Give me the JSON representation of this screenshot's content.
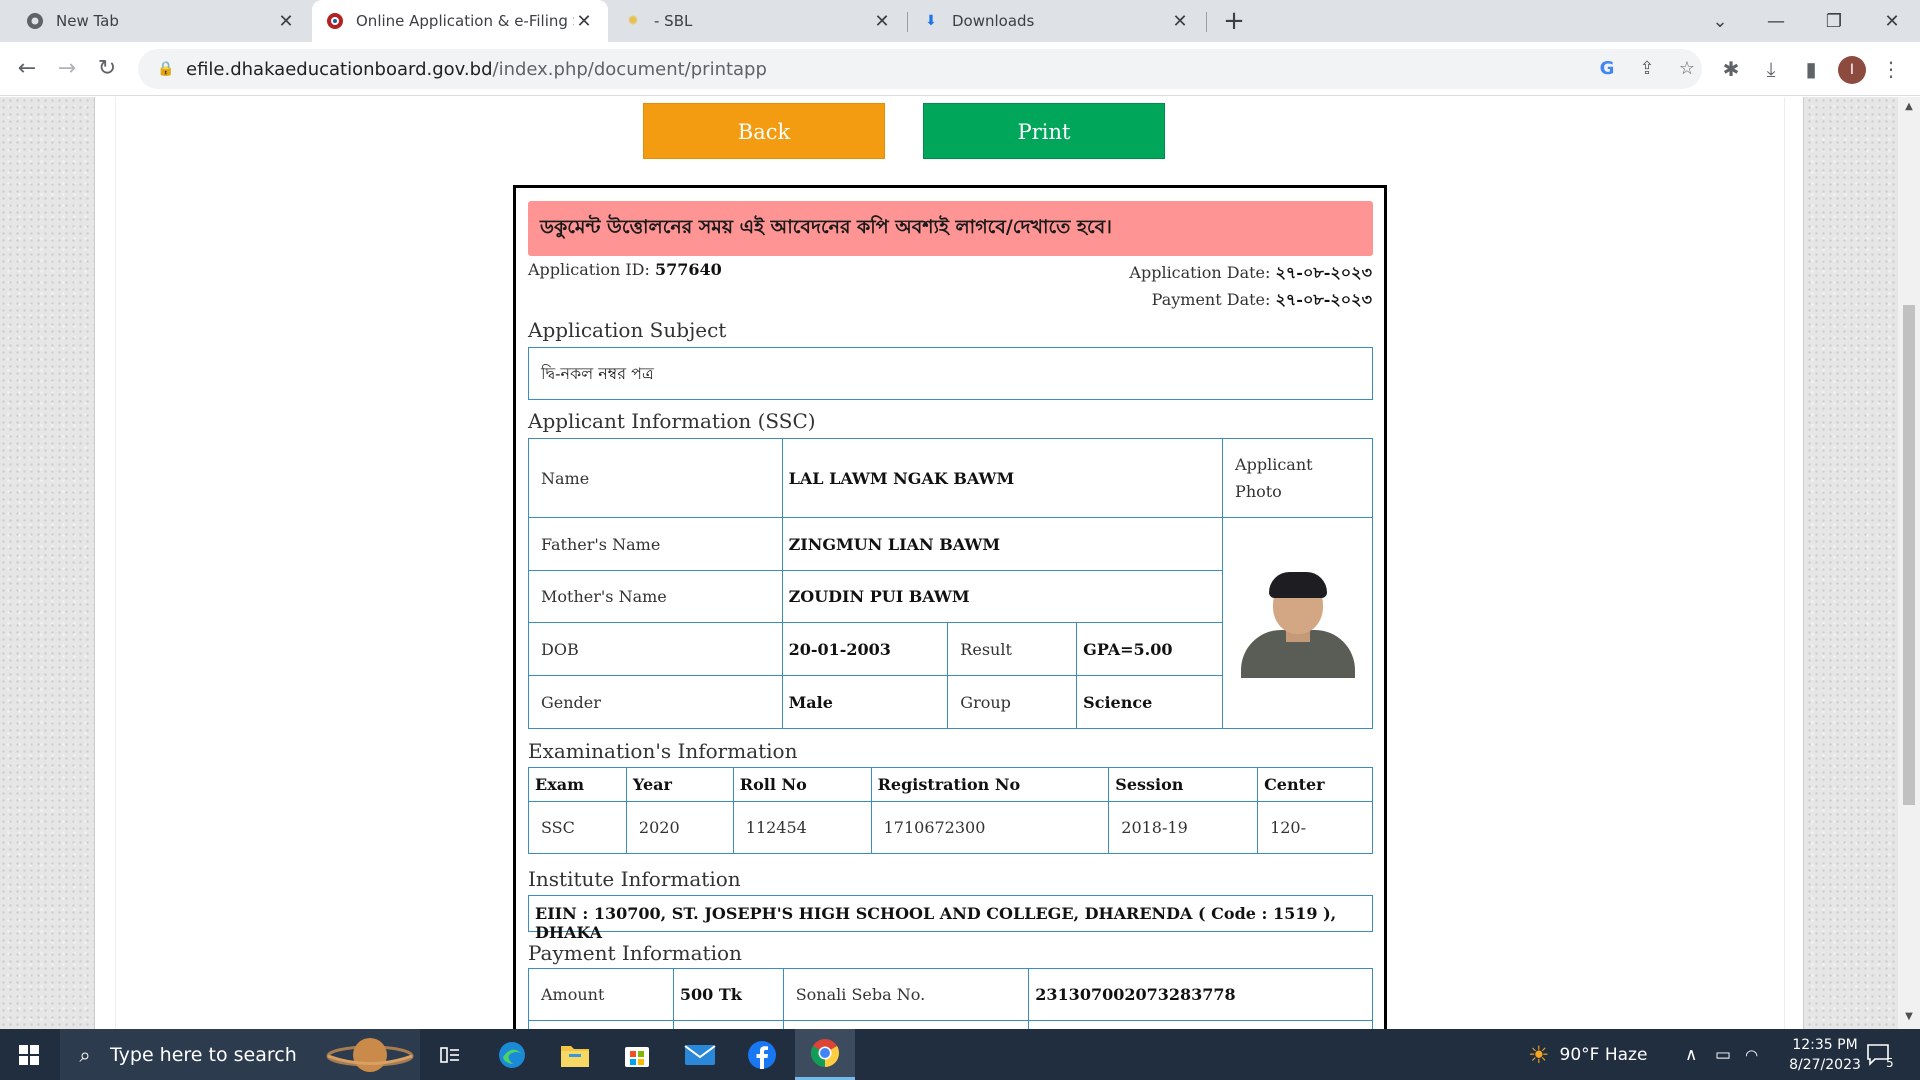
{
  "browser": {
    "tabs": [
      {
        "title": "New Tab",
        "icon": "chrome-icon"
      },
      {
        "title": "Online Application & e-Filing Sys",
        "icon": "board-logo-icon"
      },
      {
        "title": "- SBL",
        "icon": "sun-favicon-icon"
      },
      {
        "title": "Downloads",
        "icon": "download-icon"
      }
    ],
    "url_host": "efile.dhakaeducationboard.gov.bd",
    "url_path": "/index.php/document/printapp",
    "avatar_letter": "I"
  },
  "page": {
    "back_label": "Back",
    "print_label": "Print",
    "alert": "ডকুমেন্ট উত্তোলনের সময় এই আবেদনের কপি অবশ্যই লাগবে/দেখাতে হবে।",
    "application_id_label": "Application ID:",
    "application_id": "577640",
    "application_date_label": "Application Date:",
    "application_date": "২৭-০৮-২০২৩",
    "payment_date_label": "Payment Date:",
    "payment_date": "২৭-০৮-২০২৩",
    "subject_title": "Application Subject",
    "subject_value": "দ্বি-নকল নম্বর পত্র",
    "applicant": {
      "title": "Applicant Information (SSC)",
      "name_label": "Name",
      "name": "LAL LAWM NGAK BAWM",
      "photo_label": "Applicant Photo",
      "father_label": "Father's Name",
      "father": "ZINGMUN LIAN BAWM",
      "mother_label": "Mother's Name",
      "mother": "ZOUDIN PUI BAWM",
      "dob_label": "DOB",
      "dob": "20-01-2003",
      "result_label": "Result",
      "result": "GPA=5.00",
      "gender_label": "Gender",
      "gender": "Male",
      "group_label": "Group",
      "group": "Science"
    },
    "exam": {
      "title": "Examination's Information",
      "headers": [
        "Exam",
        "Year",
        "Roll No",
        "Registration No",
        "Session",
        "Center"
      ],
      "row": [
        "SSC",
        "2020",
        "112454",
        "1710672300",
        "2018-19",
        "120-"
      ]
    },
    "institute": {
      "title": "Institute Information",
      "value": "EIIN : 130700, ST. JOSEPH'S HIGH SCHOOL AND COLLEGE, DHARENDA ( Code : 1519 ), DHAKA"
    },
    "payment": {
      "title": "Payment Information",
      "amount_label": "Amount",
      "amount": "500 Tk",
      "seba_label": "Sonali Seba No.",
      "seba": "231307002073283778"
    }
  },
  "taskbar": {
    "search_placeholder": "Type here to search",
    "weather": "90°F  Haze",
    "time": "12:35 PM",
    "date": "8/27/2023",
    "notification_count": "5"
  },
  "colors": {
    "back_button": "#f39c12",
    "print_button": "#00a65a",
    "alert_bg": "#ff9494",
    "table_border": "#3c8dbc"
  }
}
